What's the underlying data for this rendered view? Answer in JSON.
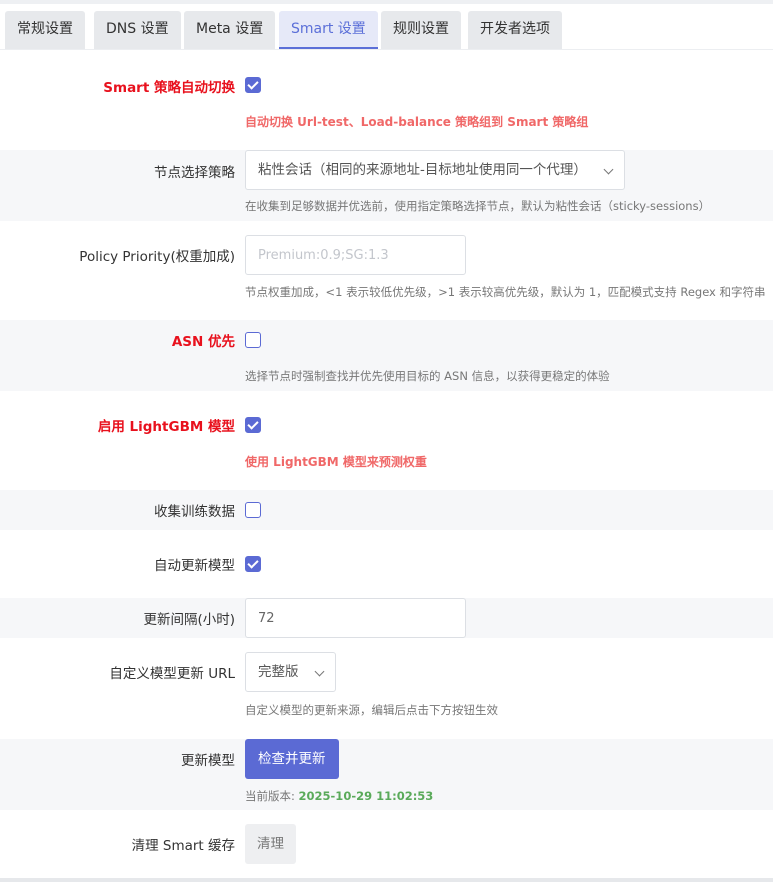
{
  "tabs": [
    {
      "label": "常规设置",
      "active": false
    },
    {
      "label": "DNS 设置",
      "active": false
    },
    {
      "label": "Meta 设置",
      "active": false
    },
    {
      "label": "Smart 设置",
      "active": true
    },
    {
      "label": "规则设置",
      "active": false
    },
    {
      "label": "开发者选项",
      "active": false
    }
  ],
  "smart_auto_switch": {
    "label": "Smart 策略自动切换",
    "checked": true,
    "description": "自动切换 Url-test、Load-balance 策略组到 Smart 策略组"
  },
  "node_strategy": {
    "label": "节点选择策略",
    "value": "粘性会话（相同的来源地址-目标地址使用同一个代理）",
    "description": "在收集到足够数据并优选前，使用指定策略选择节点，默认为粘性会话（sticky-sessions）"
  },
  "policy_priority": {
    "label": "Policy Priority(权重加成)",
    "value": "",
    "placeholder": "Premium:0.9;SG:1.3",
    "description": "节点权重加成，<1 表示较低优先级，>1 表示较高优先级，默认为 1，匹配模式支持 Regex 和字符串"
  },
  "asn_priority": {
    "label": "ASN 优先",
    "checked": false,
    "description": "选择节点时强制查找并优先使用目标的 ASN 信息，以获得更稳定的体验"
  },
  "lightgbm": {
    "label": "启用 LightGBM 模型",
    "checked": true,
    "description": "使用 LightGBM 模型来预测权重"
  },
  "collect_training": {
    "label": "收集训练数据",
    "checked": false
  },
  "auto_update_model": {
    "label": "自动更新模型",
    "checked": true
  },
  "update_interval": {
    "label": "更新间隔(小时)",
    "value": "72"
  },
  "custom_model_url": {
    "label": "自定义模型更新 URL",
    "value": "完整版",
    "description": "自定义模型的更新来源，编辑后点击下方按钮生效"
  },
  "update_model": {
    "label": "更新模型",
    "button": "检查并更新",
    "version_prefix": "当前版本: ",
    "version": "2025-10-29 11:02:53"
  },
  "clear_cache": {
    "label": "清理 Smart 缓存",
    "button": "清理"
  },
  "colors": {
    "accent": "#5b6ad4",
    "warning_label": "#e8111d",
    "warning_desc": "#f06868",
    "version": "#5aaa5a"
  }
}
